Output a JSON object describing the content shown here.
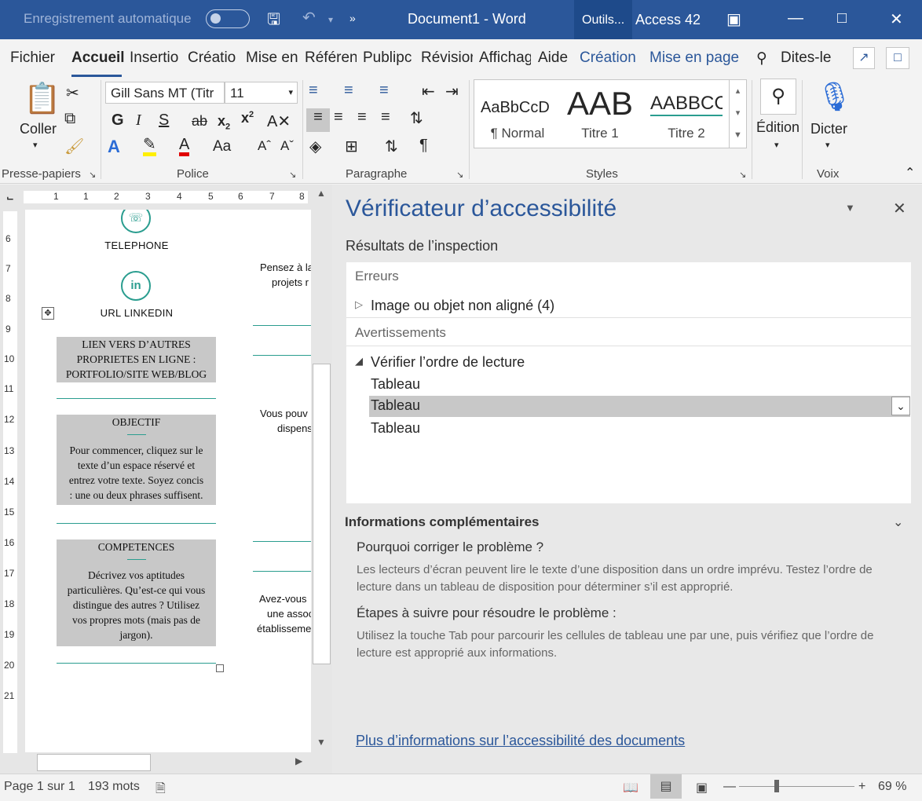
{
  "titlebar": {
    "autosave_label": "Enregistrement automatique",
    "document_title": "Document1  -  Word",
    "context_tab": "Outils...",
    "user": "Access 42"
  },
  "tabs": [
    "Fichier",
    "Accueil",
    "Insertio",
    "Créatio",
    "Mise en",
    "Référen",
    "Publipc",
    "Révisior",
    "Affichag",
    "Aide",
    "Création",
    "Mise en page",
    "Dites-le"
  ],
  "ribbon": {
    "clipboard": {
      "paste_label": "Coller",
      "group": "Presse-papiers"
    },
    "font": {
      "name": "Gill Sans MT (Titr",
      "size": "11",
      "group": "Police",
      "bold": "G",
      "italic": "I",
      "underline": "S",
      "strike": "ab",
      "change_case": "Aa",
      "grow": "A^",
      "shrink": "A˅"
    },
    "paragraph": {
      "group": "Paragraphe",
      "pilcrow": "¶"
    },
    "styles": {
      "group": "Styles",
      "items": [
        {
          "preview": "AaBbCcD",
          "name": "¶ Normal"
        },
        {
          "preview": "AAB",
          "name": "Titre 1"
        },
        {
          "preview": "AABBCC",
          "name": "Titre 2"
        }
      ]
    },
    "editing": {
      "label": "Édition"
    },
    "dictate": {
      "label": "Dicter",
      "group": "Voix"
    }
  },
  "document": {
    "ruler_numbers": [
      "1",
      "1",
      "2",
      "3",
      "4",
      "5",
      "6",
      "7",
      "8"
    ],
    "vruler_numbers": [
      "6",
      "7",
      "8",
      "9",
      "10",
      "11",
      "12",
      "13",
      "14",
      "15",
      "16",
      "17",
      "18",
      "19",
      "20",
      "21"
    ],
    "telephone": "TELEPHONE",
    "linkedin": "URL LINKEDIN",
    "linkedin_icon": "in",
    "links_box": [
      "LIEN VERS D’AUTRES",
      "PROPRIETES EN LIGNE :",
      "PORTFOLIO/SITE WEB/BLOG"
    ],
    "objective_title": "OBJECTIF",
    "objective_text": [
      "Pour commencer, cliquez sur le",
      "texte d’un espace réservé et",
      "entrez votre texte. Soyez concis",
      ": une ou deux phrases suffisent."
    ],
    "skills_title": "COMPETENCES",
    "skills_text": [
      "Décrivez vos aptitudes",
      "particulières. Qu’est-ce qui vous",
      "distingue des autres ? Utilisez",
      "vos propres mots (mais pas de",
      "jargon)."
    ],
    "right_col": [
      "Pensez à la",
      "projets r",
      "Vous pouv",
      "dispens",
      "Avez-vous",
      "une assoc",
      "établisseme"
    ]
  },
  "pane": {
    "title": "Vérificateur d’accessibilité",
    "results_label": "Résultats de l’inspection",
    "errors_header": "Erreurs",
    "error_item": "Image ou objet non aligné (4)",
    "warnings_header": "Avertissements",
    "warning_item": "Vérifier l’ordre de lecture",
    "sub_items": [
      "Tableau",
      "Tableau",
      "Tableau"
    ],
    "more_info": "Informations complémentaires",
    "why_title": "Pourquoi corriger le problème ?",
    "why_text": [
      "Les lecteurs d’écran peuvent lire le texte d’une disposition dans un ordre imprévu. Testez l’ordre de",
      "lecture dans un tableau de disposition pour déterminer s’il est approprié."
    ],
    "steps_title": "Étapes à suivre pour résoudre le problème :",
    "steps_text": [
      "Utilisez la touche Tab pour parcourir les cellules de tableau une par une, puis vérifiez que l’ordre de",
      "lecture est approprié aux informations."
    ],
    "link": "Plus d’informations sur l’accessibilité des documents"
  },
  "status": {
    "page": "Page 1 sur 1",
    "words": "193 mots",
    "zoom": "69 %"
  },
  "colors": {
    "brand": "#2b579a",
    "teal": "#2a9d8f"
  }
}
